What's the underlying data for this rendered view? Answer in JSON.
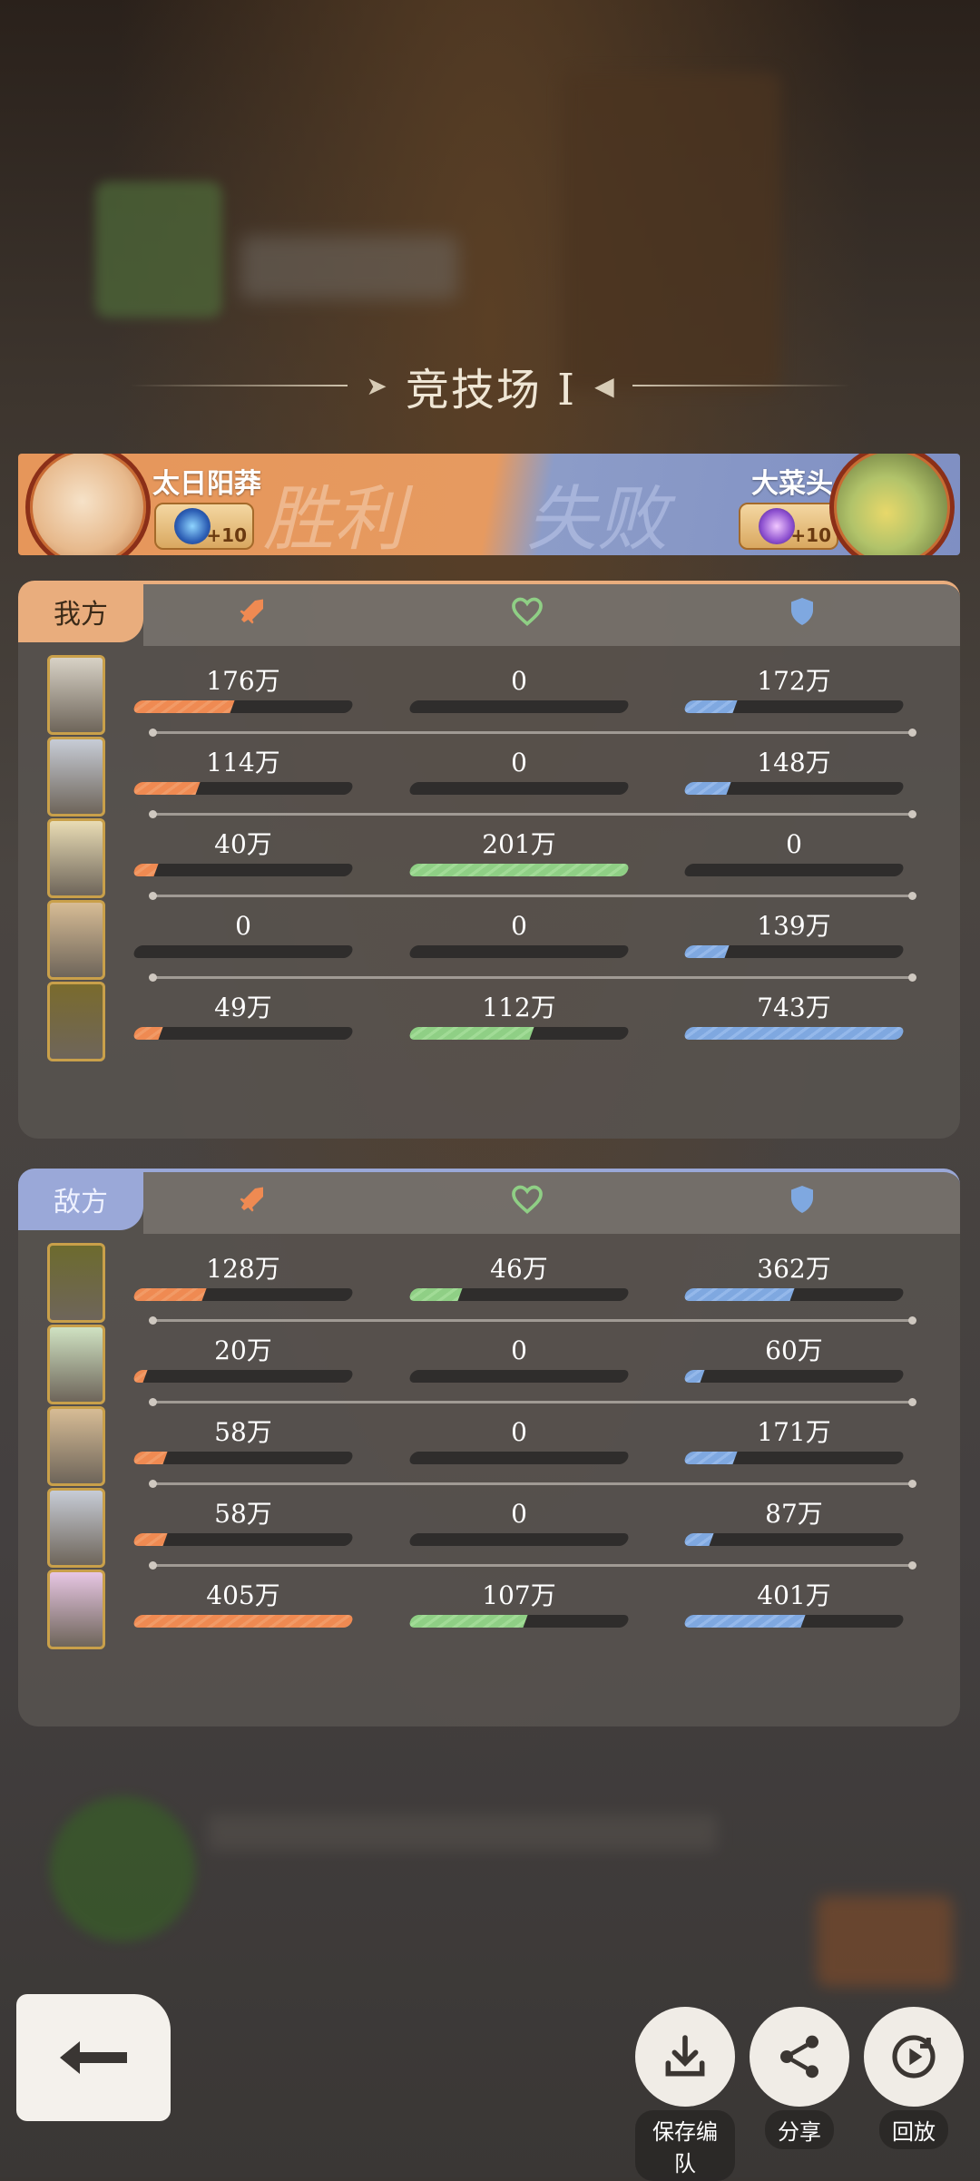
{
  "header": {
    "title": "竞技场 I"
  },
  "battle": {
    "left_player": {
      "name": "太日阳莽",
      "rank_plus": "+10"
    },
    "right_player": {
      "name": "大菜头",
      "rank_plus": "+10"
    },
    "win_text": "胜利",
    "lose_text": "失败"
  },
  "ours": {
    "label": "我方",
    "rows": [
      {
        "atk": "176万",
        "atk_pct": 0.45,
        "heal": "0",
        "heal_pct": 0,
        "def": "172万",
        "def_pct": 0.23
      },
      {
        "atk": "114万",
        "atk_pct": 0.29,
        "heal": "0",
        "heal_pct": 0,
        "def": "148万",
        "def_pct": 0.2
      },
      {
        "atk": "40万",
        "atk_pct": 0.1,
        "heal": "201万",
        "heal_pct": 1.0,
        "def": "0",
        "def_pct": 0
      },
      {
        "atk": "0",
        "atk_pct": 0,
        "heal": "0",
        "heal_pct": 0,
        "def": "139万",
        "def_pct": 0.19
      },
      {
        "atk": "49万",
        "atk_pct": 0.12,
        "heal": "112万",
        "heal_pct": 0.56,
        "def": "743万",
        "def_pct": 1.0
      }
    ]
  },
  "enemy": {
    "label": "敌方",
    "rows": [
      {
        "atk": "128万",
        "atk_pct": 0.32,
        "heal": "46万",
        "heal_pct": 0.23,
        "def": "362万",
        "def_pct": 0.49
      },
      {
        "atk": "20万",
        "atk_pct": 0.05,
        "heal": "0",
        "heal_pct": 0,
        "def": "60万",
        "def_pct": 0.08
      },
      {
        "atk": "58万",
        "atk_pct": 0.14,
        "heal": "0",
        "heal_pct": 0,
        "def": "171万",
        "def_pct": 0.23
      },
      {
        "atk": "58万",
        "atk_pct": 0.14,
        "heal": "0",
        "heal_pct": 0,
        "def": "87万",
        "def_pct": 0.12
      },
      {
        "atk": "405万",
        "atk_pct": 1.0,
        "heal": "107万",
        "heal_pct": 0.53,
        "def": "401万",
        "def_pct": 0.54
      }
    ]
  },
  "actions": {
    "save_label": "保存编队",
    "share_label": "分享",
    "replay_label": "回放"
  },
  "colors": {
    "attack": "#ef8a52",
    "heal": "#8fcf85",
    "defense": "#7fa8e0"
  }
}
